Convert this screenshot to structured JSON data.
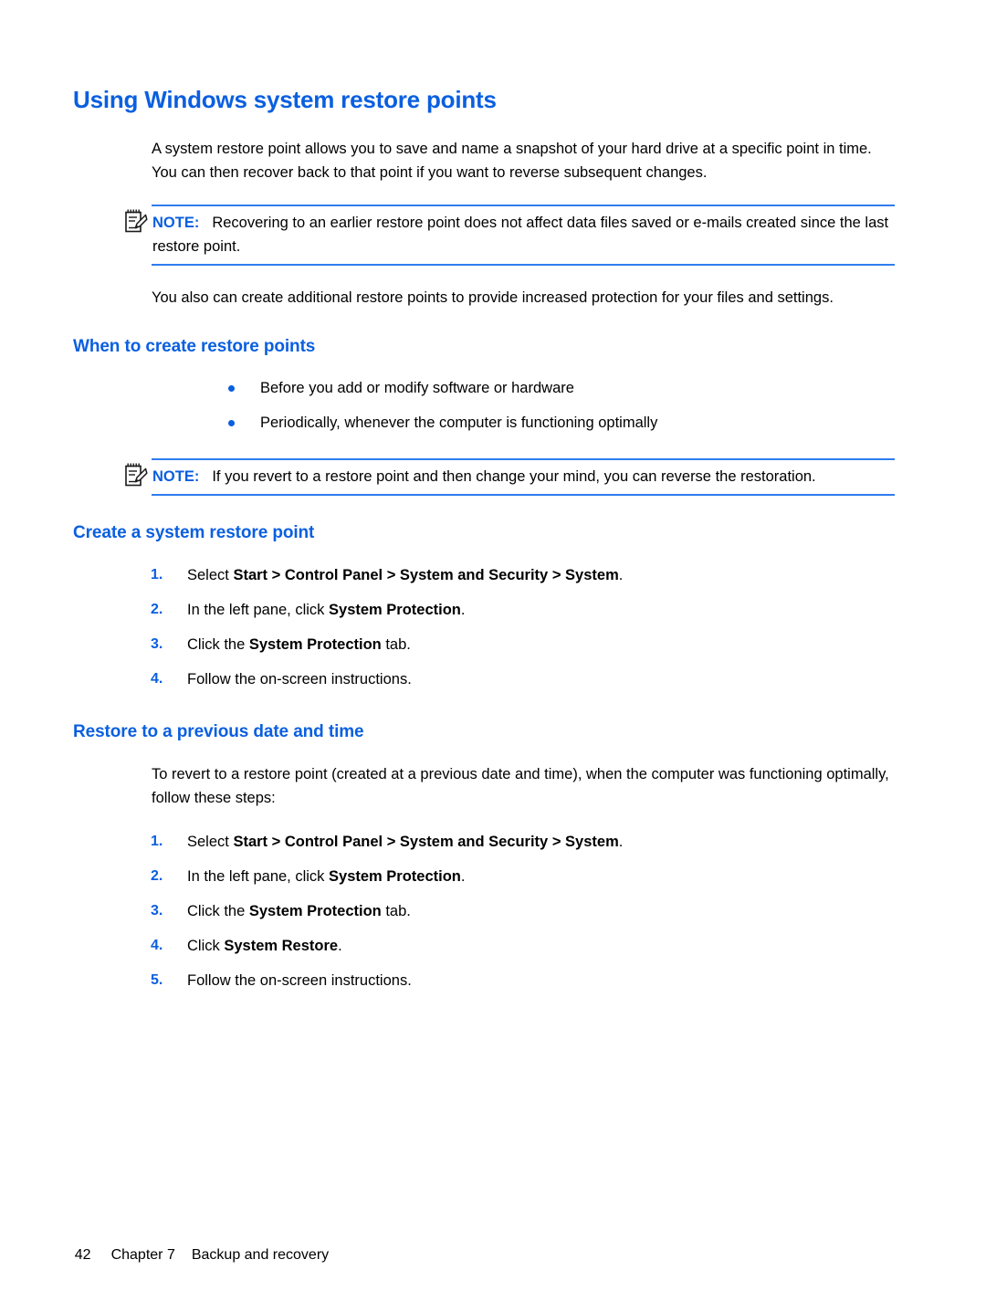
{
  "theme": {
    "accent_blue": "#0A5FE0",
    "rule_blue": "#2E7DEE",
    "text_black": "#000000",
    "background": "#ffffff"
  },
  "document": {
    "title": "Using Windows system restore points",
    "intro_paragraph": "A system restore point allows you to save and name a snapshot of your hard drive at a specific point in time. You can then recover back to that point if you want to reverse subsequent changes.",
    "second_paragraph": "You also can create additional restore points to provide increased protection for your files and settings."
  },
  "notes": [
    {
      "icon": "note-pencil-icon",
      "label": "NOTE:",
      "text": "Recovering to an earlier restore point does not affect data files saved or e-mails created since the last restore point."
    },
    {
      "icon": "note-pencil-icon",
      "label": "NOTE:",
      "text": "If you revert to a restore point and then change your mind, you can reverse the restoration."
    }
  ],
  "sections": {
    "when_to_create": {
      "heading": "When to create restore points",
      "bullets": [
        "Before you add or modify software or hardware",
        "Periodically, whenever the computer is functioning optimally"
      ]
    },
    "create_restore_point": {
      "heading": "Create a system restore point",
      "steps": [
        {
          "number": "1.",
          "parts": [
            {
              "text": "Select ",
              "bold": false
            },
            {
              "text": "Start > Control Panel > System and Security > System",
              "bold": true
            },
            {
              "text": ".",
              "bold": false
            }
          ]
        },
        {
          "number": "2.",
          "parts": [
            {
              "text": "In the left pane, click ",
              "bold": false
            },
            {
              "text": "System Protection",
              "bold": true
            },
            {
              "text": ".",
              "bold": false
            }
          ]
        },
        {
          "number": "3.",
          "parts": [
            {
              "text": "Click the ",
              "bold": false
            },
            {
              "text": "System Protection",
              "bold": true
            },
            {
              "text": " tab.",
              "bold": false
            }
          ]
        },
        {
          "number": "4.",
          "parts": [
            {
              "text": "Follow the on-screen instructions.",
              "bold": false
            }
          ]
        }
      ]
    },
    "restore_previous": {
      "heading": "Restore to a previous date and time",
      "paragraph": "To revert to a restore point (created at a previous date and time), when the computer was functioning optimally, follow these steps:",
      "steps": [
        {
          "number": "1.",
          "parts": [
            {
              "text": "Select ",
              "bold": false
            },
            {
              "text": "Start > Control Panel > System and Security > System",
              "bold": true
            },
            {
              "text": ".",
              "bold": false
            }
          ]
        },
        {
          "number": "2.",
          "parts": [
            {
              "text": "In the left pane, click ",
              "bold": false
            },
            {
              "text": "System Protection",
              "bold": true
            },
            {
              "text": ".",
              "bold": false
            }
          ]
        },
        {
          "number": "3.",
          "parts": [
            {
              "text": "Click the ",
              "bold": false
            },
            {
              "text": "System Protection",
              "bold": true
            },
            {
              "text": " tab.",
              "bold": false
            }
          ]
        },
        {
          "number": "4.",
          "parts": [
            {
              "text": "Click ",
              "bold": false
            },
            {
              "text": "System Restore",
              "bold": true
            },
            {
              "text": ".",
              "bold": false
            }
          ]
        },
        {
          "number": "5.",
          "parts": [
            {
              "text": "Follow the on-screen instructions.",
              "bold": false
            }
          ]
        }
      ]
    }
  },
  "footer": {
    "page_number": "42",
    "chapter": "Chapter 7",
    "chapter_title": "Backup and recovery"
  }
}
